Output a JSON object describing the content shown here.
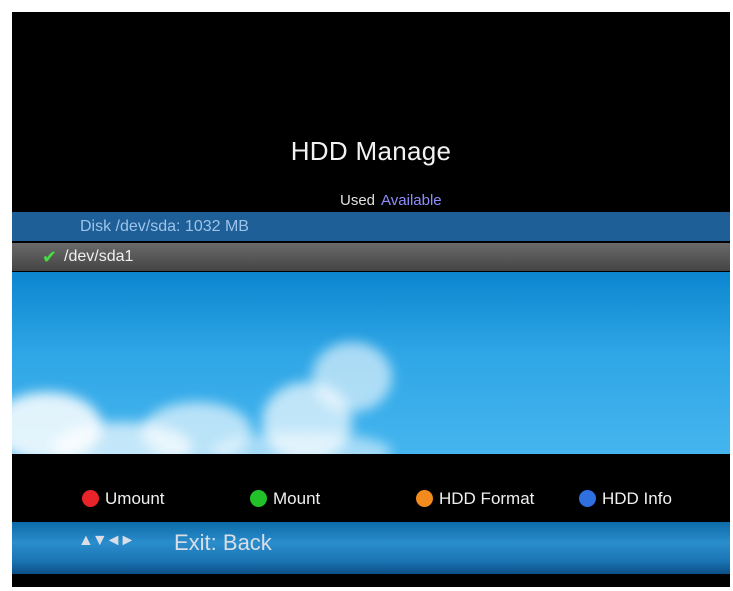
{
  "screen": {
    "title": "HDD Manage",
    "legend": {
      "used": "Used",
      "available": "Available"
    },
    "disk": {
      "label": "Disk /dev/sda: 1032 MB"
    },
    "partitions": [
      {
        "name": "/dev/sda1",
        "selected": true
      }
    ],
    "buttons": [
      {
        "label": "Umount",
        "color": "#e8232a",
        "icon": "red-button-icon"
      },
      {
        "label": "Mount",
        "color": "#22c12a",
        "icon": "green-button-icon"
      },
      {
        "label": "HDD Format",
        "color": "#f28a1e",
        "icon": "orange-button-icon"
      },
      {
        "label": "HDD Info",
        "color": "#2f6fe0",
        "icon": "blue-button-icon"
      }
    ],
    "footer": {
      "nav_symbols": "▲▼◄►",
      "exit_label": "Exit: Back"
    }
  }
}
